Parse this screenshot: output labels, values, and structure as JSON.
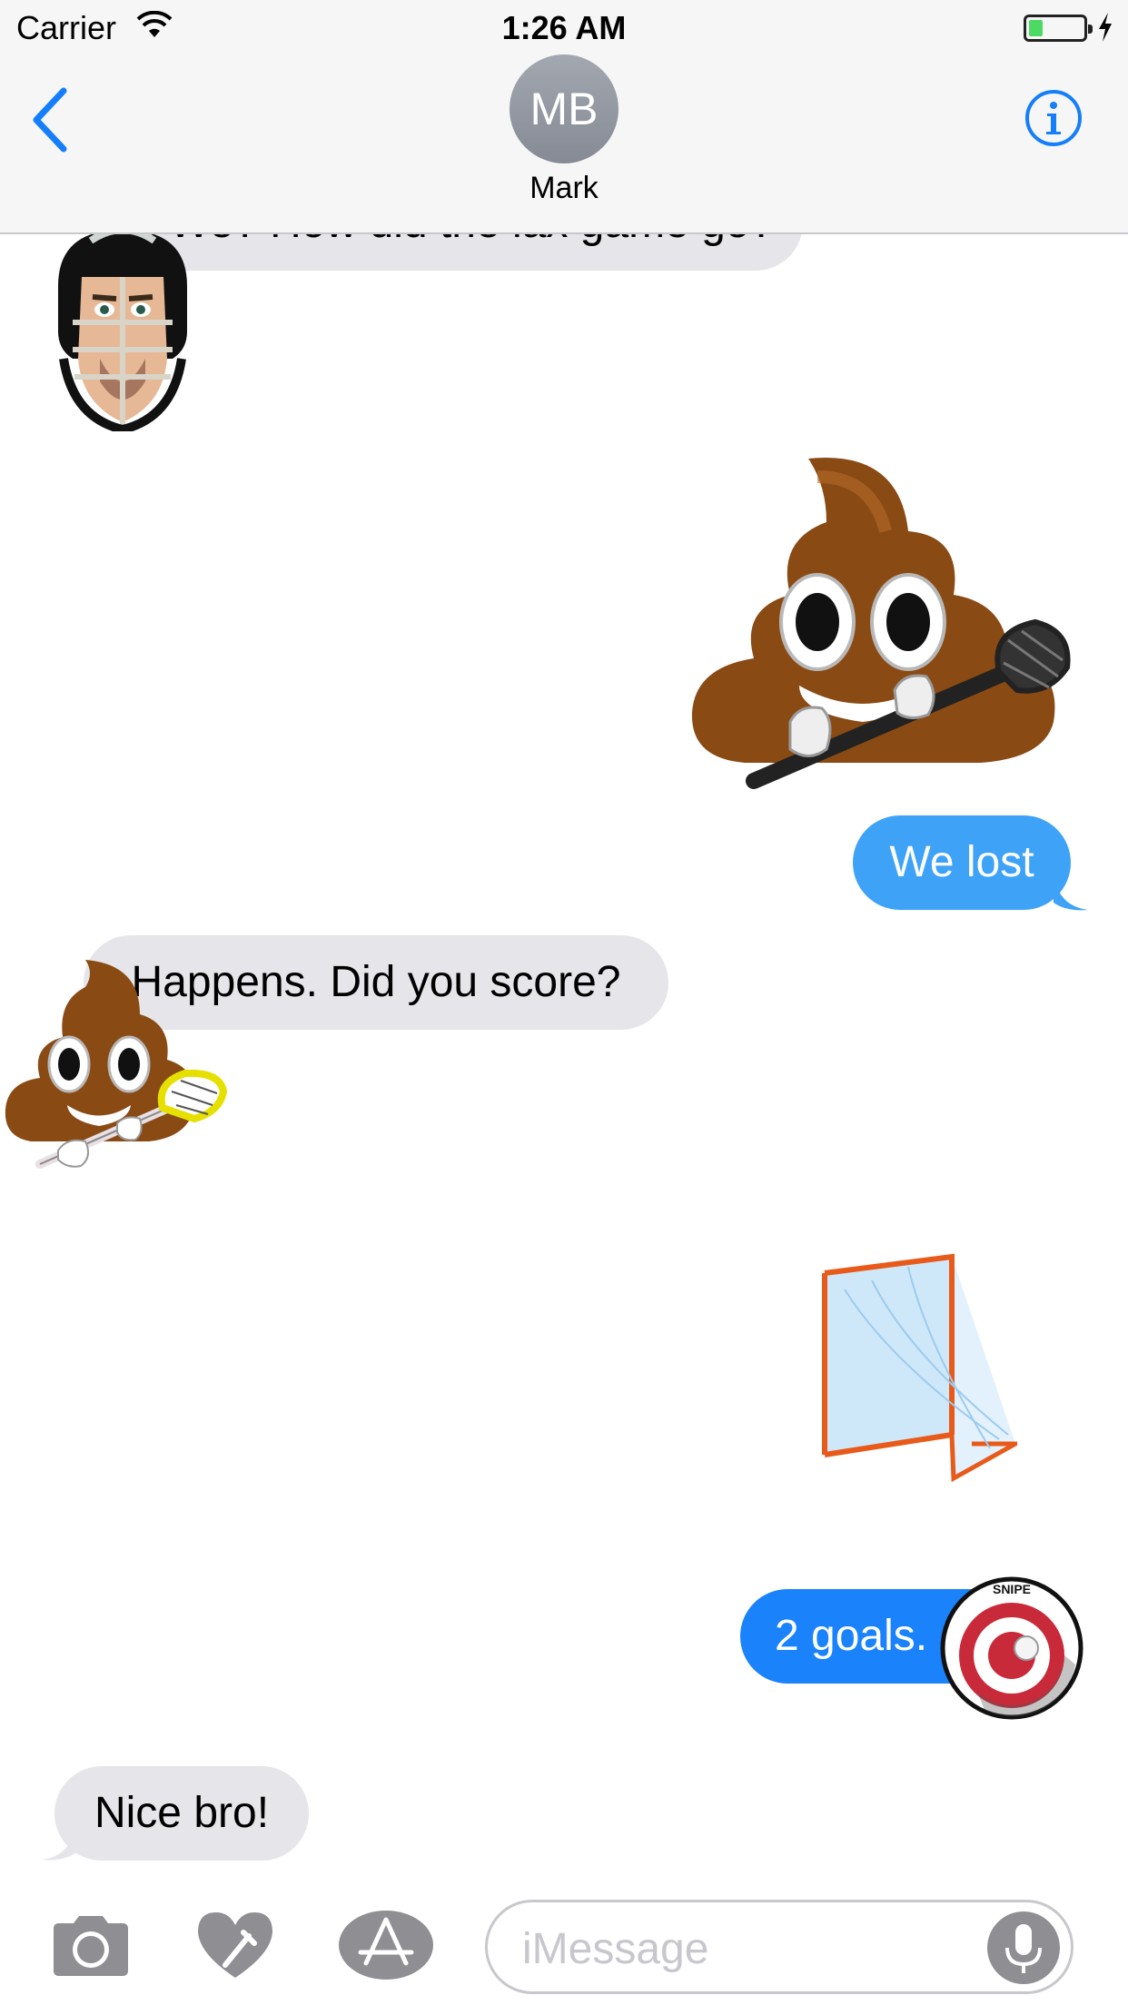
{
  "status_bar": {
    "carrier": "Carrier",
    "time": "1:26 AM",
    "battery_level": 0.25,
    "battery_color": "#4cd964"
  },
  "header": {
    "back_icon": "chevron-left-icon",
    "avatar_initials": "MB",
    "contact_name": "Mark",
    "info_icon": "info-circle-icon",
    "accent_color": "#147efb"
  },
  "messages": [
    {
      "direction": "incoming",
      "kind": "text",
      "text": "We? How did the lax game go?"
    },
    {
      "direction": "incoming",
      "kind": "sticker",
      "sticker": "lacrosse-goalie-helmet-sticker"
    },
    {
      "direction": "outgoing",
      "kind": "sticker",
      "sticker": "poop-emoji-with-lacrosse-stick-sticker"
    },
    {
      "direction": "outgoing",
      "kind": "text",
      "text": "We lost"
    },
    {
      "direction": "incoming",
      "kind": "text",
      "text": "Happens. Did you score?"
    },
    {
      "direction": "incoming",
      "kind": "sticker",
      "sticker": "poop-emoji-with-lacrosse-stick-sticker"
    },
    {
      "direction": "outgoing",
      "kind": "sticker",
      "sticker": "lacrosse-goal-net-sticker"
    },
    {
      "direction": "outgoing",
      "kind": "text",
      "text": "2 goals."
    },
    {
      "direction": "outgoing",
      "kind": "sticker",
      "sticker": "snipe-target-sticker",
      "sticker_text": "SNIPE"
    },
    {
      "direction": "incoming",
      "kind": "text",
      "text": "Nice bro!"
    }
  ],
  "input_bar": {
    "camera_icon": "camera-icon",
    "digital_touch_icon": "digital-touch-heart-icon",
    "app_store_icon": "app-store-icon",
    "placeholder": "iMessage",
    "mic_icon": "microphone-icon"
  },
  "colors": {
    "incoming_bubble": "#e5e5ea",
    "outgoing_bubble_light": "#3ea2f7",
    "outgoing_bubble_dark": "#1a82fb"
  }
}
